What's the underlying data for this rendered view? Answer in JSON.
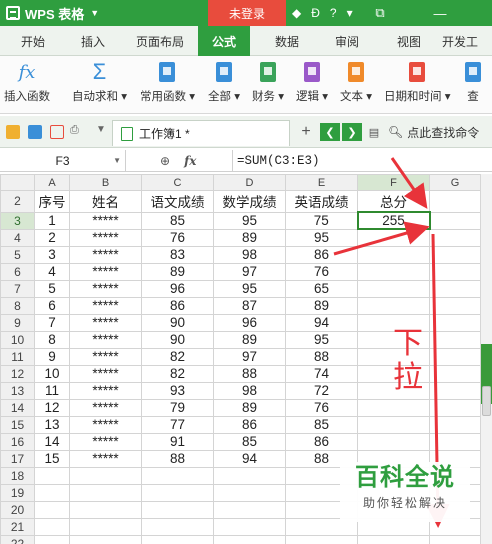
{
  "titlebar": {
    "app_name": "WPS 表格",
    "login_label": "未登录",
    "icons": [
      "shirt-icon",
      "skin-icon",
      "help-icon",
      "menu-icon",
      "restore-icon",
      "minimize-icon"
    ]
  },
  "ribbon_tabs": [
    "开始",
    "插入",
    "页面布局",
    "公式",
    "数据",
    "审阅",
    "视图",
    "开发工"
  ],
  "active_tab": "公式",
  "ribbon_buttons": [
    {
      "label": "插入函数",
      "icon": "fx-icon"
    },
    {
      "label": "自动求和",
      "icon": "sigma-icon"
    },
    {
      "label": "常用函数",
      "icon": "star-book-icon"
    },
    {
      "label": "全部",
      "icon": "list-book-icon"
    },
    {
      "label": "财务",
      "icon": "money-book-icon"
    },
    {
      "label": "逻辑",
      "icon": "question-book-icon"
    },
    {
      "label": "文本",
      "icon": "text-book-icon"
    },
    {
      "label": "日期和时间",
      "icon": "clock-book-icon"
    },
    {
      "label": "查",
      "icon": "lookup-book-icon"
    }
  ],
  "ribbon_colors": {
    "accent": "#2f9e3f",
    "fx": "#3a8fd8",
    "sigma": "#3a8fd8",
    "star": "#3a8fd8",
    "all": "#3a8fd8",
    "finance": "#3aa35a",
    "logic": "#9a59c9",
    "text": "#f08a2a",
    "date": "#e84c3d"
  },
  "doc_tab": "工作簿1 *",
  "find_command": "点此查找命令",
  "name_box": "F3",
  "formula": "=SUM(C3:E3)",
  "column_headers": [
    "A",
    "B",
    "C",
    "D",
    "E",
    "F",
    "G"
  ],
  "header_row": {
    "row": "2",
    "cells": [
      "序号",
      "姓名",
      "语文成绩",
      "数学成绩",
      "英语成绩",
      "总分"
    ]
  },
  "rows": [
    {
      "row": "3",
      "cells": [
        "1",
        "*****",
        "85",
        "95",
        "75",
        "255"
      ]
    },
    {
      "row": "4",
      "cells": [
        "2",
        "*****",
        "76",
        "89",
        "95",
        ""
      ]
    },
    {
      "row": "5",
      "cells": [
        "3",
        "*****",
        "83",
        "98",
        "86",
        ""
      ]
    },
    {
      "row": "6",
      "cells": [
        "4",
        "*****",
        "89",
        "97",
        "76",
        ""
      ]
    },
    {
      "row": "7",
      "cells": [
        "5",
        "*****",
        "96",
        "95",
        "65",
        ""
      ]
    },
    {
      "row": "8",
      "cells": [
        "6",
        "*****",
        "86",
        "87",
        "89",
        ""
      ]
    },
    {
      "row": "9",
      "cells": [
        "7",
        "*****",
        "90",
        "96",
        "94",
        ""
      ]
    },
    {
      "row": "10",
      "cells": [
        "8",
        "*****",
        "90",
        "89",
        "95",
        ""
      ]
    },
    {
      "row": "11",
      "cells": [
        "9",
        "*****",
        "82",
        "97",
        "88",
        ""
      ]
    },
    {
      "row": "12",
      "cells": [
        "10",
        "*****",
        "82",
        "88",
        "74",
        ""
      ]
    },
    {
      "row": "13",
      "cells": [
        "11",
        "*****",
        "93",
        "98",
        "72",
        ""
      ]
    },
    {
      "row": "14",
      "cells": [
        "12",
        "*****",
        "79",
        "89",
        "76",
        ""
      ]
    },
    {
      "row": "15",
      "cells": [
        "13",
        "*****",
        "77",
        "86",
        "85",
        ""
      ]
    },
    {
      "row": "16",
      "cells": [
        "14",
        "*****",
        "91",
        "85",
        "86",
        ""
      ]
    },
    {
      "row": "17",
      "cells": [
        "15",
        "*****",
        "88",
        "94",
        "88",
        ""
      ]
    },
    {
      "row": "18",
      "cells": [
        "",
        "",
        "",
        "",
        "",
        ""
      ]
    },
    {
      "row": "19",
      "cells": [
        "",
        "",
        "",
        "",
        "",
        ""
      ]
    },
    {
      "row": "20",
      "cells": [
        "",
        "",
        "",
        "",
        "",
        ""
      ]
    },
    {
      "row": "21",
      "cells": [
        "",
        "",
        "",
        "",
        "",
        ""
      ]
    },
    {
      "row": "22",
      "cells": [
        "",
        "",
        "",
        "",
        "",
        ""
      ]
    }
  ],
  "selected_cell": "F3",
  "annotation": {
    "text_line1": "下",
    "text_line2": "拉",
    "color": "#e8333a"
  },
  "watermark": {
    "title": "百科全说",
    "subtitle": "助你轻松解决"
  }
}
